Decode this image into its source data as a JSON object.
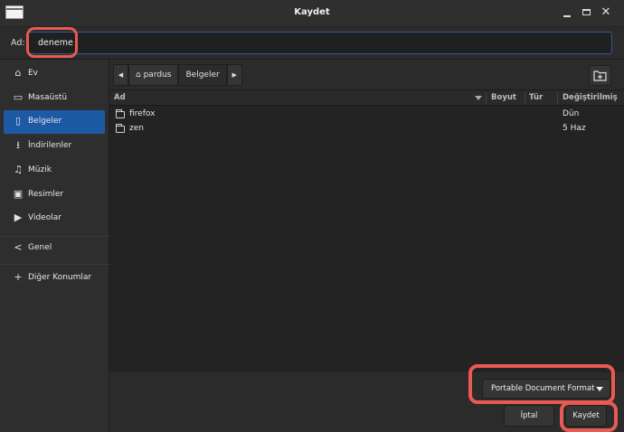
{
  "window": {
    "title": "Kaydet"
  },
  "name_row": {
    "label": "Ad:",
    "value": "deneme"
  },
  "sidebar": {
    "items": [
      {
        "label": "Ev",
        "icon": "home-icon",
        "glyph": "⌂"
      },
      {
        "label": "Masaüstü",
        "icon": "folder-icon",
        "glyph": "▭"
      },
      {
        "label": "Belgeler",
        "icon": "document-icon",
        "glyph": "▯",
        "active": true
      },
      {
        "label": "İndirilenler",
        "icon": "download-icon",
        "glyph": "⭳"
      },
      {
        "label": "Müzik",
        "icon": "music-icon",
        "glyph": "♫"
      },
      {
        "label": "Resimler",
        "icon": "picture-icon",
        "glyph": "▣"
      },
      {
        "label": "Videolar",
        "icon": "video-icon",
        "glyph": "▶"
      },
      {
        "label": "Genel",
        "icon": "share-icon",
        "glyph": "<"
      },
      {
        "label": "Diğer Konumlar",
        "icon": "plus-icon",
        "glyph": "+"
      }
    ]
  },
  "path_bar": {
    "segments": [
      "pardus",
      "Belgeler"
    ],
    "home_glyph": "⌂"
  },
  "file_list": {
    "columns": [
      "Ad",
      "Boyut",
      "Tür",
      "Değiştirilmiş"
    ],
    "rows": [
      {
        "name": "firefox",
        "modified": "Dün"
      },
      {
        "name": "zen",
        "modified": "5 Haz"
      }
    ]
  },
  "footer": {
    "file_type": "Portable Document Format",
    "cancel_label": "İptal",
    "save_label": "Kaydet"
  },
  "colors": {
    "accent": "#1d5aa6",
    "annotation": "#e95a52"
  }
}
